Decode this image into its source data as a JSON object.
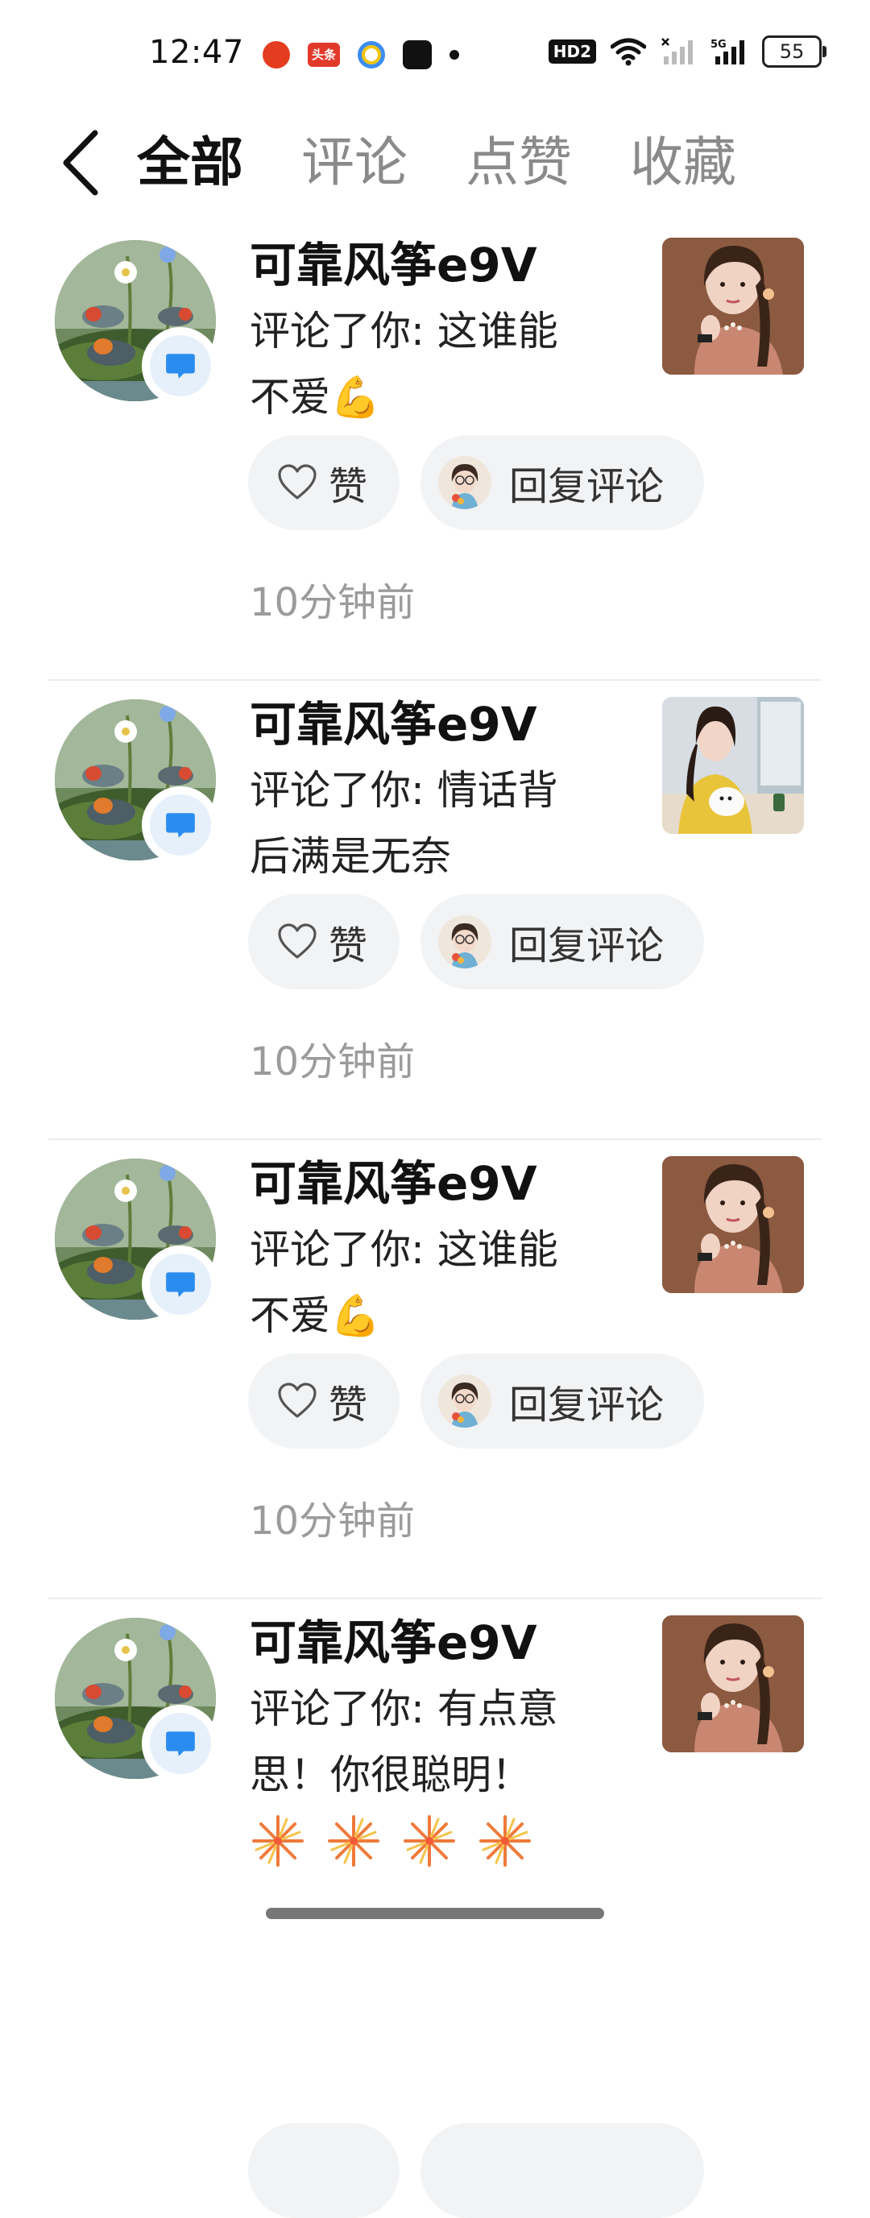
{
  "status_bar": {
    "time": "12:47",
    "toutiao_label": "头条",
    "hd_label": "HD2",
    "network_label": "5G",
    "battery": "55"
  },
  "header": {
    "tabs": [
      {
        "label": "全部",
        "active": true
      },
      {
        "label": "评论",
        "active": false
      },
      {
        "label": "点赞",
        "active": false
      },
      {
        "label": "收藏",
        "active": false
      }
    ]
  },
  "notifications": [
    {
      "username": "可靠风筝e9V",
      "comment_lines": [
        "评论了你: 这谁能",
        "不爱💪"
      ],
      "like_label": "赞",
      "reply_label": "回复评论",
      "time": "10分钟前",
      "thumb": "woman-pink-sweater"
    },
    {
      "username": "可靠风筝e9V",
      "comment_lines": [
        "评论了你: 情话背",
        "后满是无奈"
      ],
      "like_label": "赞",
      "reply_label": "回复评论",
      "time": "10分钟前",
      "thumb": "woman-yellow-cardigan-dog"
    },
    {
      "username": "可靠风筝e9V",
      "comment_lines": [
        "评论了你: 这谁能",
        "不爱💪"
      ],
      "like_label": "赞",
      "reply_label": "回复评论",
      "time": "10分钟前",
      "thumb": "woman-pink-sweater"
    },
    {
      "username": "可靠风筝e9V",
      "comment_lines": [
        "评论了你: 有点意",
        "思！你很聪明！"
      ],
      "emoji_count": 4,
      "thumb": "woman-pink-sweater"
    }
  ],
  "colors": {
    "badge_blue": "#2b8cf0",
    "badge_bg": "#e6f0fb",
    "pill_bg": "#f2f3f5",
    "time_gray": "#9b9b9b",
    "tab_inactive": "#8a8a8a"
  }
}
